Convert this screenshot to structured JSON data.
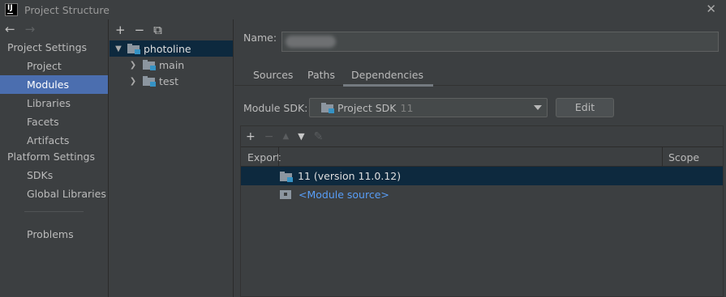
{
  "window": {
    "title": "Project Structure",
    "close_glyph": "✕",
    "logo_text": "IJ"
  },
  "nav": {
    "back_glyph": "←",
    "forward_glyph": "→"
  },
  "sidebar": {
    "project_settings_header": "Project Settings",
    "project_settings_items": [
      {
        "label": "Project",
        "selected": false
      },
      {
        "label": "Modules",
        "selected": true
      },
      {
        "label": "Libraries",
        "selected": false
      },
      {
        "label": "Facets",
        "selected": false
      },
      {
        "label": "Artifacts",
        "selected": false
      }
    ],
    "platform_settings_header": "Platform Settings",
    "platform_settings_items": [
      {
        "label": "SDKs"
      },
      {
        "label": "Global Libraries"
      }
    ],
    "problems_label": "Problems"
  },
  "tree": {
    "toolbar": {
      "add_glyph": "+",
      "remove_glyph": "−",
      "copy_glyph": "⧉"
    },
    "root": {
      "label": "photoline",
      "expanded": true,
      "selected": true
    },
    "children": [
      {
        "label": "main",
        "expanded": false
      },
      {
        "label": "test",
        "expanded": false
      }
    ]
  },
  "main": {
    "name_label": "Name:",
    "name_value_redacted": true,
    "tabs": [
      {
        "label": "Sources",
        "active": false
      },
      {
        "label": "Paths",
        "active": false
      },
      {
        "label": "Dependencies",
        "active": true
      }
    ],
    "module_sdk_label": "Module SDK:",
    "module_sdk_value": "Project SDK",
    "module_sdk_version": "11",
    "edit_button": "Edit",
    "dep_toolbar": {
      "add": "+",
      "remove": "−",
      "up": "▲",
      "down": "▼",
      "edit": "✎"
    },
    "dep_table": {
      "columns": {
        "export": "Export",
        "scope": "Scope"
      },
      "rows": [
        {
          "label": "11 (version 11.0.12)",
          "selected": true,
          "icon": "sdk-folder-icon"
        },
        {
          "label": "<Module source>",
          "selected": false,
          "icon": "module-source-icon",
          "link": true
        }
      ]
    }
  },
  "colors": {
    "background": "#3c3f41",
    "selection": "#4b6eaf",
    "tree_selection": "#0d293e",
    "link": "#589df6",
    "folder_badge": "#3592c4"
  }
}
